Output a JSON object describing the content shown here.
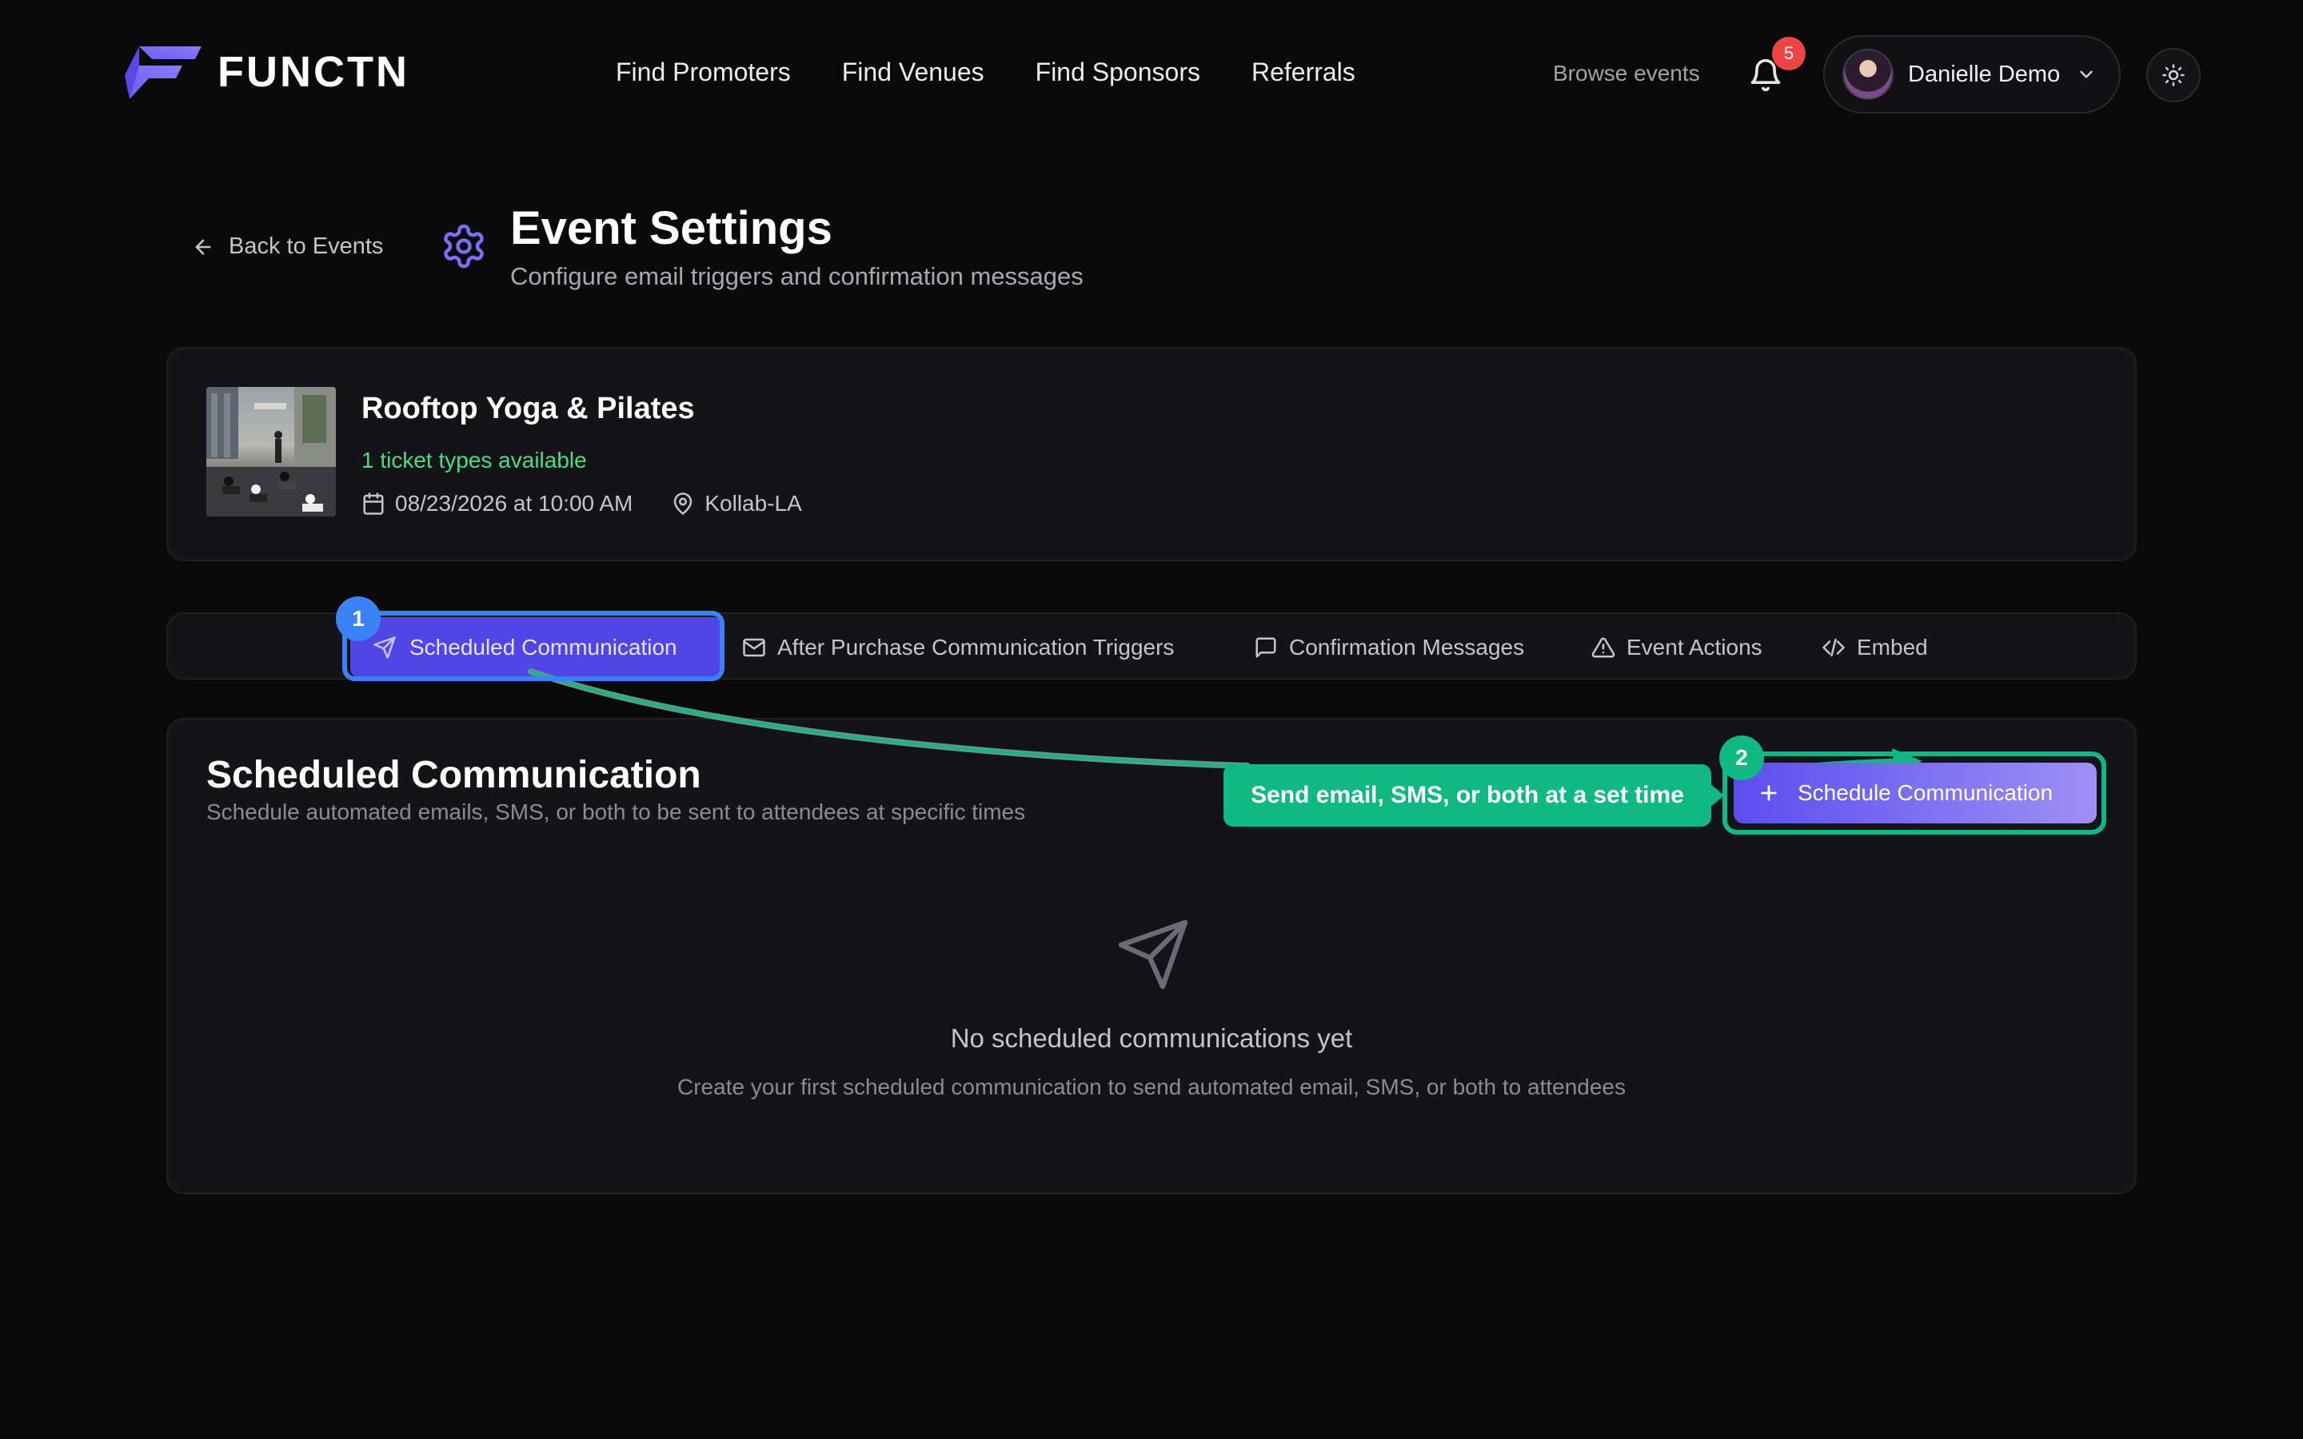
{
  "header": {
    "brand": "FUNCTN",
    "nav": [
      "Find Promoters",
      "Find Venues",
      "Find Sponsors",
      "Referrals"
    ],
    "browse": "Browse events",
    "notifications": "5",
    "user_name": "Danielle Demo"
  },
  "page": {
    "back_label": "Back to Events",
    "title": "Event Settings",
    "subtitle": "Configure email triggers and confirmation messages"
  },
  "event": {
    "title": "Rooftop Yoga & Pilates",
    "tickets": "1 ticket types available",
    "datetime": "08/23/2026 at 10:00 AM",
    "location": "Kollab-LA"
  },
  "tabs": {
    "scheduled": "Scheduled Communication",
    "after_purchase": "After Purchase Communication Triggers",
    "confirmation": "Confirmation Messages",
    "actions": "Event Actions",
    "embed": "Embed"
  },
  "section": {
    "title": "Scheduled Communication",
    "subtitle": "Schedule automated emails, SMS, or both to be sent to attendees at specific times",
    "button": "Schedule Communication",
    "empty_title": "No scheduled communications yet",
    "empty_sub": "Create your first scheduled communication to send automated email, SMS, or both to attendees"
  },
  "annotations": {
    "step1": "1",
    "step2": "2",
    "callout": "Send email, SMS, or both at a set time"
  },
  "colors": {
    "accent": "#4f46e5",
    "highlight_blue": "#3b82f6",
    "highlight_green": "#10b981",
    "success_text": "#4ade80"
  }
}
